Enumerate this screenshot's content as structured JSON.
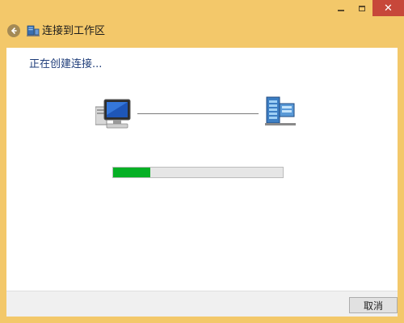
{
  "window": {
    "title": "连接到工作区",
    "caption": {
      "minimize": "—",
      "maximize": "□",
      "close": "✕"
    }
  },
  "header": {
    "back_icon": "back-arrow-icon",
    "title_icon": "network-workspace-icon"
  },
  "main": {
    "heading": "正在创建连接...",
    "progress": {
      "value_fraction": 0.22,
      "color": "#06b025"
    },
    "left_icon": "computer-icon",
    "right_icon": "server-icon"
  },
  "footer": {
    "cancel_label": "取消"
  },
  "colors": {
    "frame": "#f3c86a",
    "close": "#c7473a",
    "heading": "#1f3d7a"
  }
}
